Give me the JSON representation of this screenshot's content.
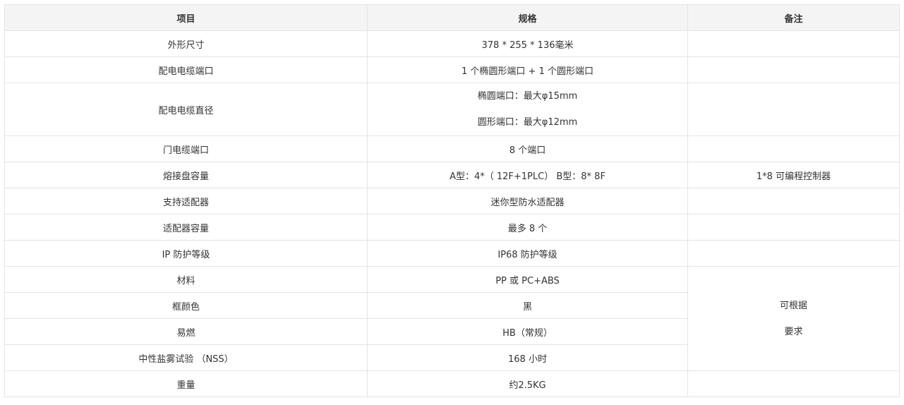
{
  "header": {
    "item": "项目",
    "spec": "规格",
    "note": "备注"
  },
  "rows": {
    "r0": {
      "item": "外形尺寸",
      "spec": "378 * 255 * 136毫米"
    },
    "r1": {
      "item": "配电电缆端口",
      "spec": "1 个椭圆形端口 + 1 个圆形端口"
    },
    "r2": {
      "item": "配电电缆直径",
      "spec_line1": "椭圆端口：最大φ15mm",
      "spec_line2": "圆形端口：最大φ12mm"
    },
    "r3": {
      "item": "门电缆端口",
      "spec": "8 个端口"
    },
    "r4": {
      "item": "熔接盘容量",
      "spec": "A型：4*（ 12F+1PLC） B型：8* 8F",
      "note": "1*8 可编程控制器"
    },
    "r5": {
      "item": "支持适配器",
      "spec": "迷你型防水适配器"
    },
    "r6": {
      "item": "适配器容量",
      "spec": "最多 8 个"
    },
    "r7": {
      "item": "IP 防护等级",
      "spec": "IP68 防护等级"
    },
    "r8": {
      "item": "材料",
      "spec": "PP 或 PC+ABS",
      "note_line1": "可根据",
      "note_line2": "要求"
    },
    "r9": {
      "item": "框颜色",
      "spec": "黑"
    },
    "r10": {
      "item": "易燃",
      "spec": "HB（常规）"
    },
    "r11": {
      "item": "中性盐雾试验 （NSS）",
      "spec": "168 小时"
    },
    "r12": {
      "item": "重量",
      "spec": "约2.5KG"
    }
  }
}
